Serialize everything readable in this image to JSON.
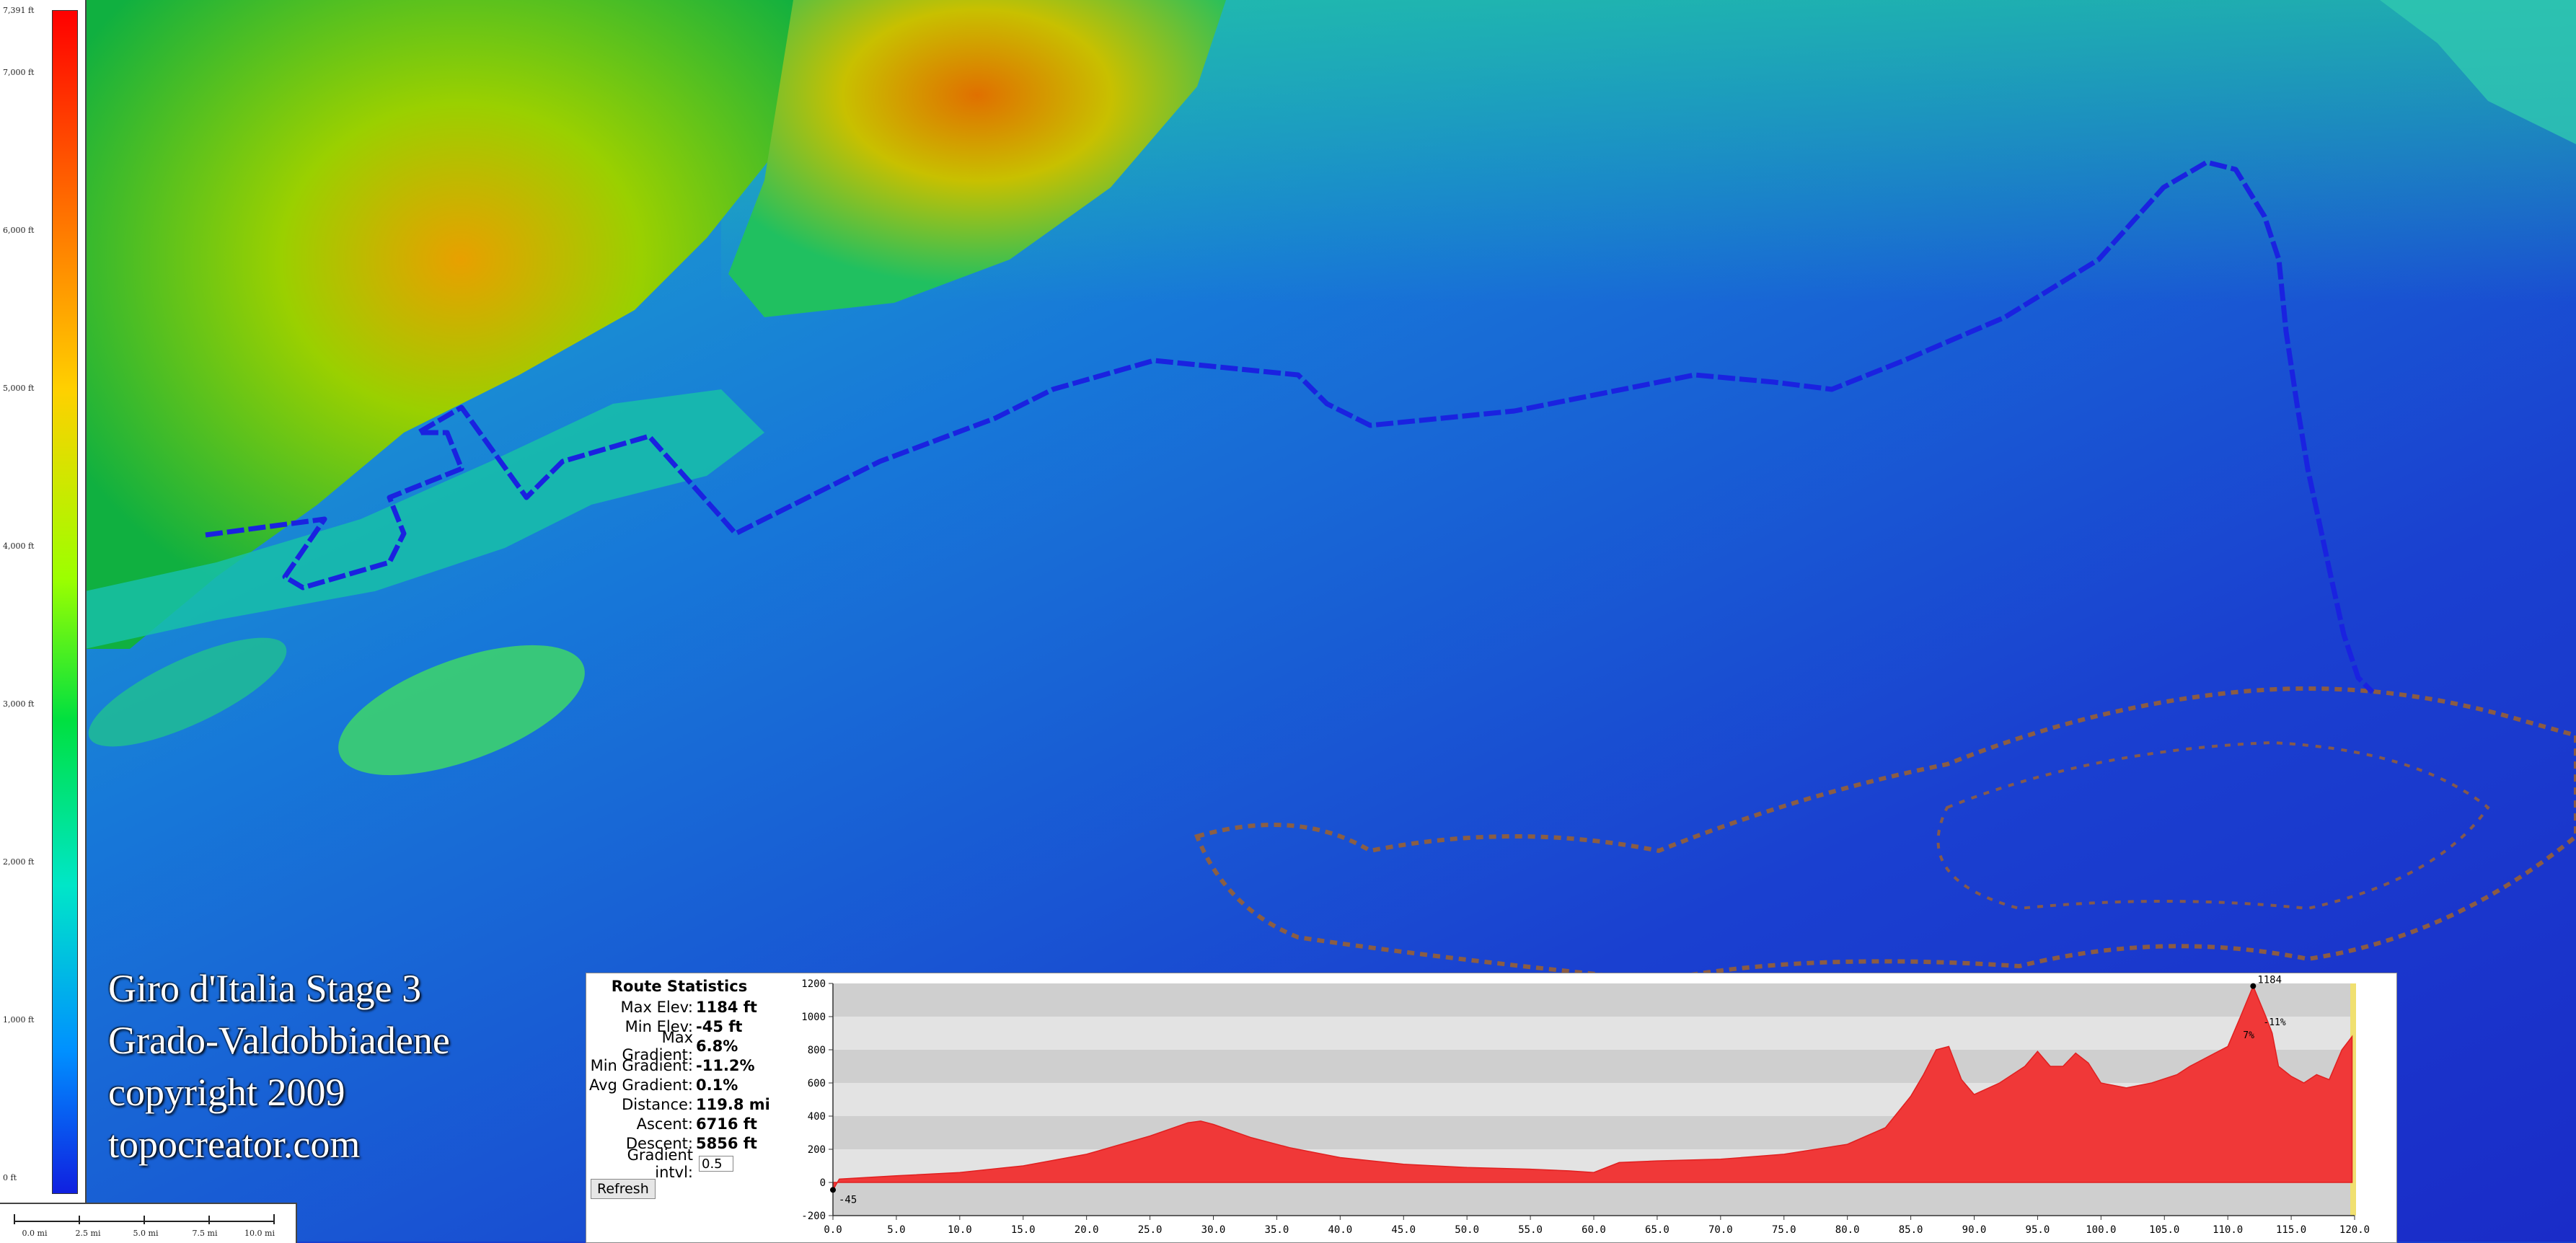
{
  "legend": {
    "labels": [
      "7,391 ft",
      "7,000 ft",
      "6,000 ft",
      "5,000 ft",
      "4,000 ft",
      "3,000 ft",
      "2,000 ft",
      "1,000 ft",
      "0 ft"
    ]
  },
  "scale": {
    "labels": [
      "0.0 mi",
      "2.5 mi",
      "5.0 mi",
      "7.5 mi",
      "10.0 mi"
    ]
  },
  "title": {
    "line1": "Giro d'Italia Stage 3",
    "line2": "Grado-Valdobbiadene",
    "line3": "copyright 2009",
    "line4": "topocreator.com"
  },
  "route_stats": {
    "heading": "Route Statistics",
    "rows": [
      {
        "label": "Max Elev:",
        "value": "1184 ft"
      },
      {
        "label": "Min Elev:",
        "value": "-45 ft"
      },
      {
        "label": "Max Gradient:",
        "value": "6.8%"
      },
      {
        "label": "Min Gradient:",
        "value": "-11.2%"
      },
      {
        "label": "Avg Gradient:",
        "value": "0.1%"
      },
      {
        "label": "Distance:",
        "value": "119.8 mi"
      },
      {
        "label": "Ascent:",
        "value": "6716 ft"
      },
      {
        "label": "Descent:",
        "value": "5856 ft"
      }
    ],
    "gradient_label": "Gradient intvl:",
    "gradient_value": "0.5",
    "refresh_label": "Refresh"
  },
  "chart_data": {
    "type": "area",
    "x_ticks": [
      "0.0",
      "5.0",
      "10.0",
      "15.0",
      "20.0",
      "25.0",
      "30.0",
      "35.0",
      "40.0",
      "45.0",
      "50.0",
      "55.0",
      "60.0",
      "65.0",
      "70.0",
      "75.0",
      "80.0",
      "85.0",
      "90.0",
      "95.0",
      "100.0",
      "105.0",
      "110.0",
      "115.0",
      "120.0"
    ],
    "y_ticks": [
      "1200",
      "1000",
      "800",
      "600",
      "400",
      "200",
      "0",
      "-200"
    ],
    "xlim": [
      0,
      120
    ],
    "ylim": [
      -200,
      1200
    ],
    "max_label": "1184",
    "min_label": "-45",
    "grade_labels": [
      "-11%",
      "7%"
    ],
    "x": [
      0,
      0.5,
      5,
      10,
      15,
      20,
      25,
      28,
      29,
      30,
      33,
      36,
      40,
      45,
      50,
      55,
      58,
      60,
      62,
      65,
      70,
      75,
      80,
      83,
      85,
      86,
      87,
      88,
      89,
      90,
      92,
      94,
      95,
      96,
      97,
      98,
      99,
      100,
      102,
      104,
      106,
      107,
      109,
      110,
      111,
      112,
      113,
      113.5,
      114,
      115,
      116,
      117,
      118,
      119,
      119.8
    ],
    "y": [
      -45,
      20,
      40,
      60,
      100,
      170,
      280,
      360,
      370,
      350,
      270,
      210,
      150,
      110,
      90,
      80,
      70,
      60,
      120,
      130,
      140,
      170,
      230,
      330,
      520,
      650,
      800,
      820,
      620,
      530,
      600,
      700,
      790,
      700,
      700,
      780,
      720,
      600,
      570,
      600,
      650,
      700,
      780,
      820,
      1000,
      1184,
      1000,
      900,
      700,
      640,
      600,
      650,
      620,
      800,
      880
    ]
  }
}
